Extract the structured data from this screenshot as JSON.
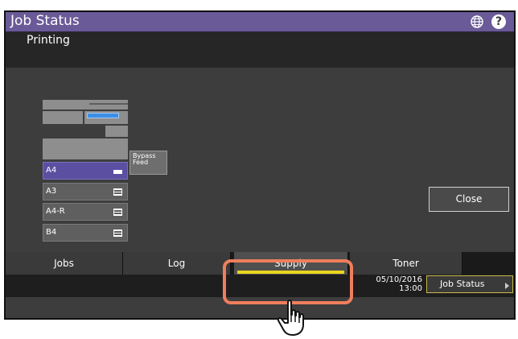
{
  "header": {
    "title": "Job Status"
  },
  "status": {
    "text": "Printing"
  },
  "trays": [
    {
      "label": "A4",
      "selected": true
    },
    {
      "label": "A3",
      "selected": false
    },
    {
      "label": "A4-R",
      "selected": false
    },
    {
      "label": "B4",
      "selected": false
    }
  ],
  "bypass": {
    "line1": "Bypass",
    "line2": "Feed"
  },
  "close_label": "Close",
  "tabs": [
    {
      "label": "Jobs"
    },
    {
      "label": "Log"
    },
    {
      "label": "Supply"
    },
    {
      "label": "Toner"
    }
  ],
  "footer": {
    "date": "05/10/2016",
    "time": "13:00",
    "job_status_label": "Job Status"
  },
  "colors": {
    "titlebar": "#6a5a97",
    "selected_tray": "#5a4fa0",
    "tab_underline": "#e8d61c",
    "highlight": "#f07e5d"
  },
  "icons": [
    "globe-icon",
    "help-icon",
    "paper-stack-icon",
    "hand-pointer-icon",
    "arrow-right-icon"
  ]
}
